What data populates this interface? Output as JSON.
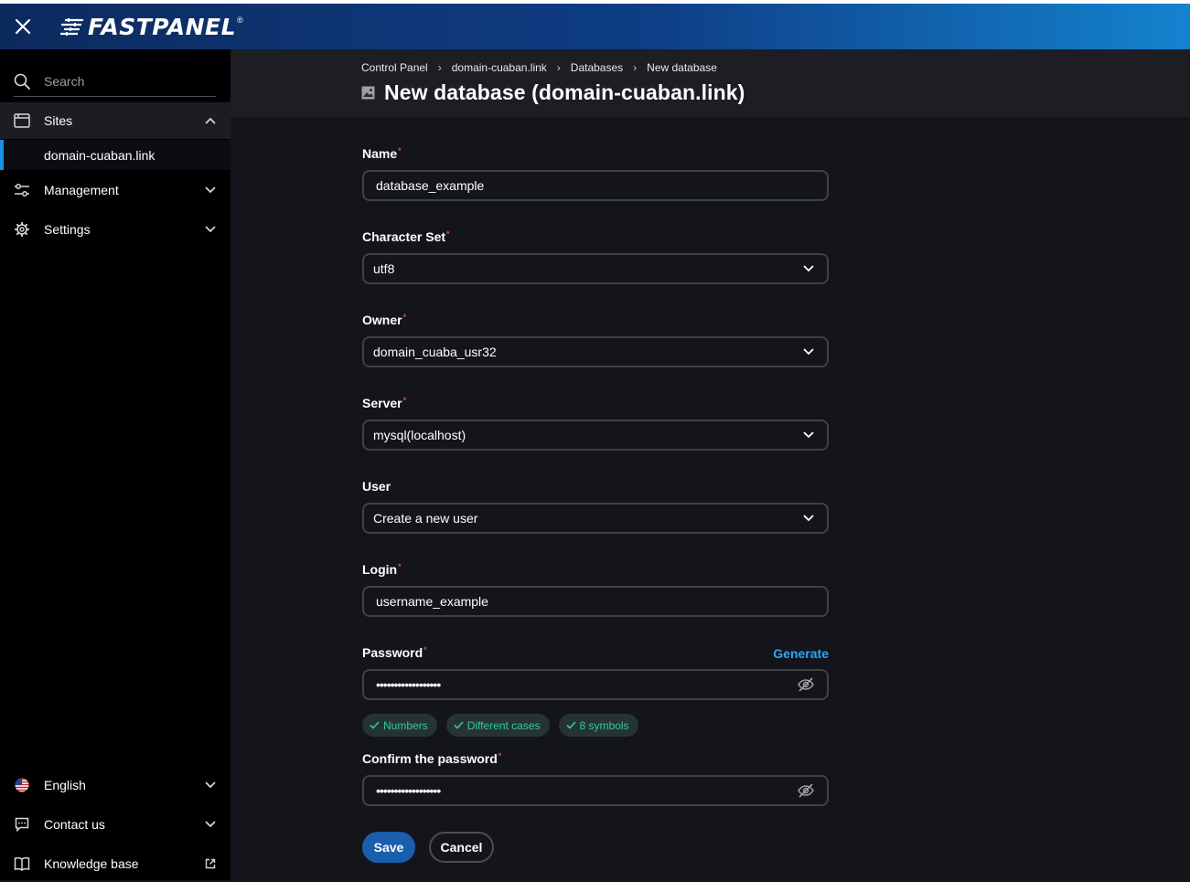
{
  "header": {
    "logo_text": "FASTPANEL",
    "logo_reg": "®"
  },
  "sidebar": {
    "search_placeholder": "Search",
    "items": [
      {
        "label": "Sites",
        "icon": "browser-window-icon"
      },
      {
        "label": "domain-cuaban.link"
      },
      {
        "label": "Management",
        "icon": "sliders-icon"
      },
      {
        "label": "Settings",
        "icon": "gear-icon"
      }
    ],
    "bottom": [
      {
        "label": "English",
        "icon": "us-flag-icon"
      },
      {
        "label": "Contact us",
        "icon": "chat-icon"
      },
      {
        "label": "Knowledge base",
        "icon": "book-icon"
      }
    ]
  },
  "breadcrumb": [
    "Control Panel",
    "domain-cuaban.link",
    "Databases",
    "New database"
  ],
  "page_title": "New database (domain-cuaban.link)",
  "form": {
    "name": {
      "label": "Name",
      "value": "database_example"
    },
    "charset": {
      "label": "Character Set",
      "value": "utf8"
    },
    "owner": {
      "label": "Owner",
      "value": "domain_cuaba_usr32"
    },
    "server": {
      "label": "Server",
      "value": "mysql(localhost)"
    },
    "user": {
      "label": "User",
      "value": "Create a new user"
    },
    "login": {
      "label": "Login",
      "value": "username_example"
    },
    "password": {
      "label": "Password",
      "value": "••••••••••••••••••",
      "generate": "Generate"
    },
    "checks": [
      "Numbers",
      "Different cases",
      "8 symbols"
    ],
    "confirm": {
      "label": "Confirm the password",
      "value": "••••••••••••••••••"
    },
    "save": "Save",
    "cancel": "Cancel"
  },
  "colors": {
    "accent": "#2ea6f2",
    "save_button": "#1a5fae",
    "check_chip_text": "#35c7a3",
    "required_mark": "#e0444b"
  }
}
